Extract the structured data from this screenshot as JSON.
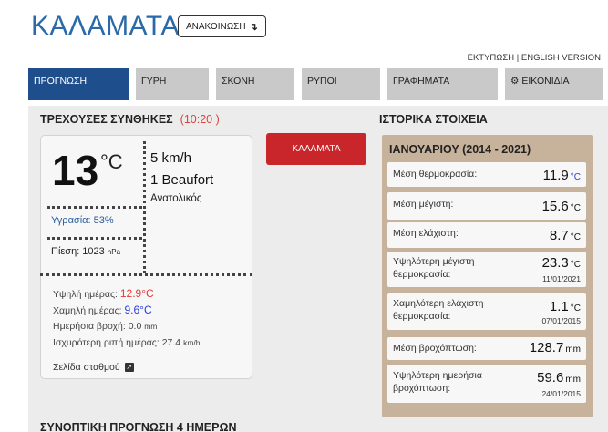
{
  "header": {
    "title": "ΚΑΛΑΜΑΤΑ",
    "announce_label": "ΑΝΑΚΟΙΝΩΣΗ",
    "announce_icon": "arrow-down-icon",
    "print_link": "ΕΚΤΥΠΩΣΗ",
    "link_separator": "|",
    "english_link": "ENGLISH VERSION"
  },
  "tabs": [
    {
      "label": "ΠΡΟΓΝΩΣΗ",
      "active": true
    },
    {
      "label": "ΓΥΡΗ",
      "active": false
    },
    {
      "label": "ΣΚΟΝΗ",
      "active": false
    },
    {
      "label": "ΡΥΠΟΙ",
      "active": false
    },
    {
      "label": "ΓΡΑΦΗΜΑΤΑ",
      "active": false
    },
    {
      "label": "ΕΙΚΟΝΙΔΙΑ",
      "active": false,
      "icon": "gear-icon"
    }
  ],
  "current": {
    "title": "ΤΡΕΧΟΥΣΕΣ ΣΥΝΘΗΚΕΣ",
    "time": "(10:20 )",
    "temperature": "13",
    "temp_unit": "°C",
    "wind_speed": "5 km/h",
    "beaufort": "1 Beaufort",
    "wind_direction": "Ανατολικός",
    "humidity": "Υγρασία: 53%",
    "pressure_label": "Πίεση: 1023",
    "pressure_unit": "hPa",
    "high_label": "Υψηλή ημέρας:",
    "high_value": "12.9°C",
    "low_label": "Χαμηλή ημέρας:",
    "low_value": "9.6°C",
    "rain_label": "Ημερήσια βροχή:",
    "rain_value": "0.0",
    "rain_unit": "mm",
    "gust_label": "Ισχυρότερη ριπή ημέρας:",
    "gust_value": "27.4",
    "gust_unit": "km/h",
    "station_link": "Σελίδα σταθμού",
    "station_icon": "external-link-icon"
  },
  "city_button": "ΚΑΛΑΜΑΤΑ",
  "history": {
    "title": "ΙΣΤΟΡΙΚΑ ΣΤΟΙΧΕΙΑ",
    "period": "ΙΑΝΟΥΑΡΙΟΥ (2014 - 2021)",
    "rows": [
      {
        "label": "Μέση θερμοκρασία:",
        "value": "11.9",
        "unit": "°C",
        "date": ""
      },
      {
        "label": "Μέση μέγιστη:",
        "value": "15.6",
        "unit": "°C",
        "date": ""
      },
      {
        "label": "Μέση ελάχιστη:",
        "value": "8.7",
        "unit": "°C",
        "date": ""
      },
      {
        "label": "Υψηλότερη μέγιστη θερμοκρασία:",
        "value": "23.3",
        "unit": "°C",
        "date": "11/01/2021"
      },
      {
        "label": "Χαμηλότερη ελάχιστη θερμοκρασία:",
        "value": "1.1",
        "unit": "°C",
        "date": "07/01/2015"
      },
      {
        "label": "Μέση βροχόπτωση:",
        "value": "128.7",
        "unit": "mm",
        "date": ""
      },
      {
        "label": "Υψηλότερη ημερήσια βροχόπτωση:",
        "value": "59.6",
        "unit": "mm",
        "date": "24/01/2015"
      }
    ]
  },
  "bottom_title": "ΣΥΝΟΠΤΙΚΗ ΠΡΟΓΝΩΣΗ 4 ΗΜΕΡΩΝ",
  "colors": {
    "accent_blue": "#1f4e8c",
    "title_blue": "#2a6aa8",
    "alert_red": "#c9262c",
    "warm_red": "#e53935",
    "cold_blue": "#2b3fd8",
    "history_bg": "#c7b29c"
  }
}
